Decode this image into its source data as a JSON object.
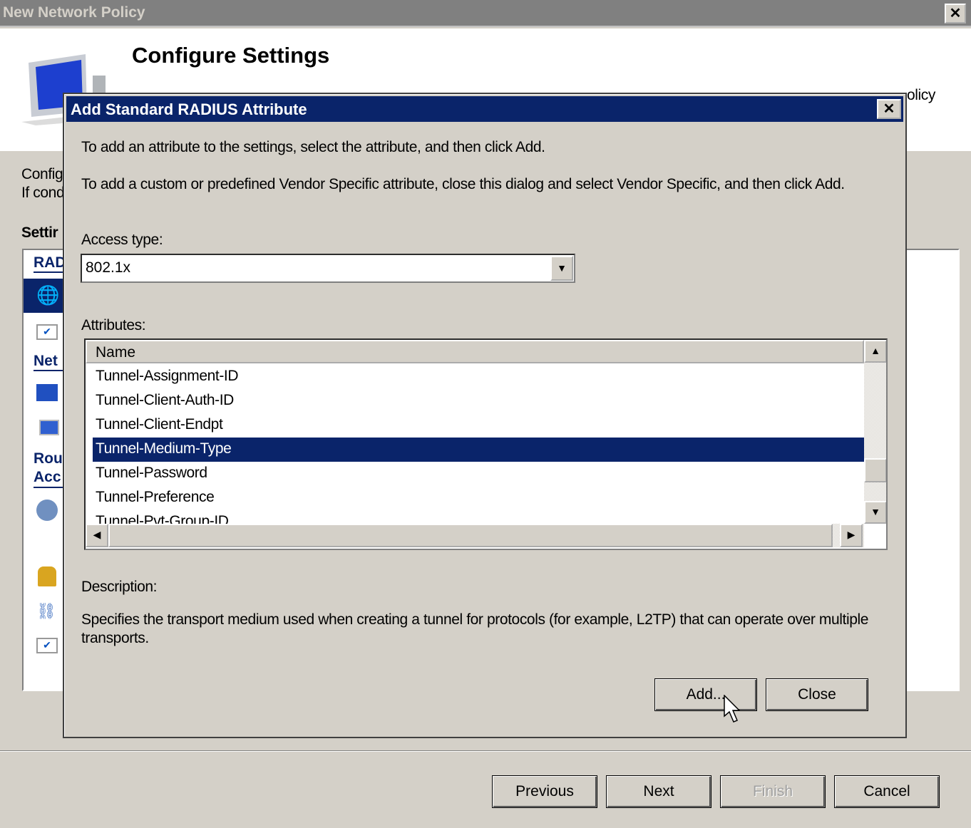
{
  "window": {
    "title": "New Network Policy",
    "close_icon": "close-icon"
  },
  "header": {
    "title": "Configure Settings",
    "subtitle_fragment": "olicy"
  },
  "left": {
    "line1": "Config",
    "line2": "If cond",
    "settings_heading": "Settir",
    "sections": [
      "RAD",
      "Net",
      "Rou",
      "Acc"
    ],
    "icons": [
      "globe-key-icon",
      "checklist-icon",
      "network-shield-icon",
      "computer-check-icon",
      "pie-chart-icon",
      "lock-icon",
      "network-icon",
      "checklist-icon"
    ]
  },
  "dialog": {
    "title": "Add Standard RADIUS Attribute",
    "intro1": "To add an attribute to the settings, select the attribute, and then click Add.",
    "intro2": "To add a custom or predefined Vendor Specific attribute, close this dialog and select Vendor Specific, and then click Add.",
    "access_type_label": "Access type:",
    "access_type_value": "802.1x",
    "attributes_label": "Attributes:",
    "column_name": "Name",
    "attributes": [
      "Tunnel-Assignment-ID",
      "Tunnel-Client-Auth-ID",
      "Tunnel-Client-Endpt",
      "Tunnel-Medium-Type",
      "Tunnel-Password",
      "Tunnel-Preference",
      "Tunnel-Pvt-Group-ID"
    ],
    "selected": "Tunnel-Medium-Type",
    "description_label": "Description:",
    "description": "Specifies the transport medium used when creating a tunnel for protocols (for example, L2TP) that can operate over multiple transports.",
    "add_label": "Add...",
    "close_label": "Close"
  },
  "footer": {
    "previous": "Previous",
    "next": "Next",
    "finish": "Finish",
    "cancel": "Cancel"
  },
  "colors": {
    "dialog_title": "#0a246a",
    "selection": "#0a246a",
    "face": "#d4d0c8"
  }
}
